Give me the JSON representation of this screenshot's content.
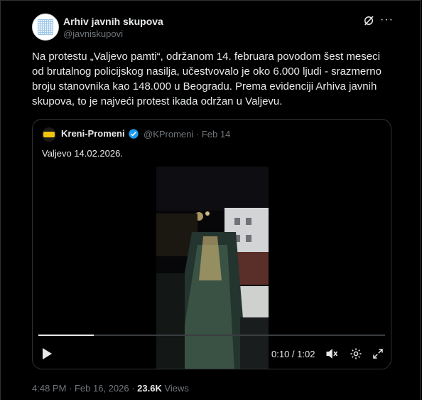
{
  "post": {
    "author_name": "Arhiv javnih skupova",
    "author_handle": "@javniskupovi",
    "text": "Na protestu „Valjevo pamti“, održanom 14. februara povodom šest meseci od brutalnog policijskog nasilja, učestvovalo je oko 6.000 ljudi - srazmerno broju stanovnika kao 148.000 u Beogradu. Prema evidenciji Arhiva javnih skupova, to je najveći protest ikada održan u Valjevu.",
    "icons": {
      "grok": "grok-icon",
      "more": "more-icon"
    }
  },
  "quote": {
    "author_name": "Kreni-Promeni",
    "author_handle": "@KPromeni",
    "date": "Feb 14",
    "meta": "@KPromeni · Feb 14",
    "text": "Valjevo 14.02.2026.",
    "verified_color": "#1d9bf0"
  },
  "video": {
    "time": "0:10 / 1:02",
    "progress": 0.16,
    "icons": {
      "play": "play-icon",
      "volume": "volume-icon",
      "settings": "settings-icon",
      "fullscreen": "fullscreen-icon"
    }
  },
  "footer": {
    "timestamp": "4:48 PM · Feb 16, 2026",
    "separator": " · ",
    "views_count": "23.6K",
    "views_label": " Views"
  }
}
